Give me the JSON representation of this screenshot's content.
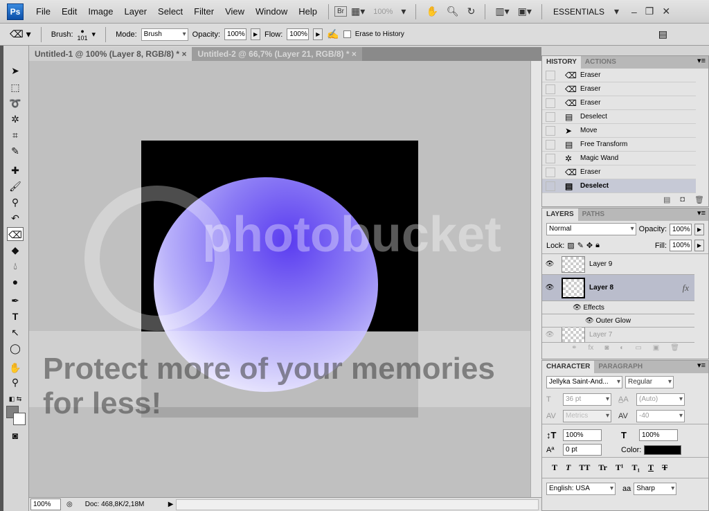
{
  "menubar": {
    "logo": "Ps",
    "items": [
      "File",
      "Edit",
      "Image",
      "Layer",
      "Select",
      "Filter",
      "View",
      "Window",
      "Help"
    ],
    "bridge": "Br",
    "zoom": "100%",
    "workspace": "ESSENTIALS"
  },
  "options": {
    "brush_label": "Brush:",
    "brush_size": "101",
    "mode_label": "Mode:",
    "mode": "Brush",
    "opacity_label": "Opacity:",
    "opacity": "100%",
    "flow_label": "Flow:",
    "flow": "100%",
    "erase_history": "Erase to History"
  },
  "tabs": [
    {
      "label": "Untitled-1 @ 100% (Layer 8, RGB/8) *"
    },
    {
      "label": "Untitled-2 @ 66,7% (Layer 21, RGB/8) *"
    }
  ],
  "watermark": {
    "logo": "photobucket",
    "text": "Protect more of your memories for less!"
  },
  "status": {
    "zoom": "100%",
    "doc": "Doc: 468,8K/2,18M"
  },
  "history": {
    "tabs": [
      "HISTORY",
      "ACTIONS"
    ],
    "items": [
      "Eraser",
      "Eraser",
      "Eraser",
      "Deselect",
      "Move",
      "Free Transform",
      "Magic Wand",
      "Eraser",
      "Deselect"
    ]
  },
  "layers": {
    "tabs": [
      "LAYERS",
      "PATHS"
    ],
    "blend": "Normal",
    "opacity_label": "Opacity:",
    "opacity": "100%",
    "lock_label": "Lock:",
    "fill_label": "Fill:",
    "fill": "100%",
    "items": [
      "Layer 9",
      "Layer 8",
      "Effects",
      "Outer Glow",
      "Layer 7"
    ],
    "fx": "fx"
  },
  "character": {
    "tabs": [
      "CHARACTER",
      "PARAGRAPH"
    ],
    "font": "Jellyka Saint-And...",
    "style": "Regular",
    "size": "36 pt",
    "leading": "(Auto)",
    "kerning": "Metrics",
    "tracking": "-40",
    "vscale": "100%",
    "hscale": "100%",
    "baseline": "0 pt",
    "color_label": "Color:",
    "color": "#000000",
    "language": "English: USA",
    "aa_label": "aa",
    "antialias": "Sharp",
    "styles": [
      "T",
      "T",
      "TT",
      "Tr",
      "T¹",
      "T₁",
      "T",
      "T"
    ]
  }
}
